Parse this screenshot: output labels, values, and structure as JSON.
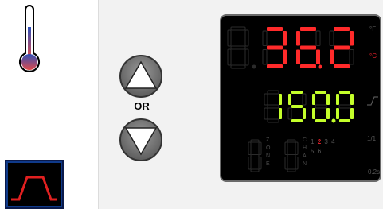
{
  "controls": {
    "or_label": "OR"
  },
  "display": {
    "process_value": "362",
    "process_value_ghost_digit": "8",
    "set_value": "150.0",
    "zone_digit": "8",
    "chan_digit": "8",
    "zone_label": [
      "Z",
      "O",
      "N",
      "E"
    ],
    "chan_label": [
      "C",
      "H",
      "A",
      "N"
    ],
    "unit_f": "°F",
    "unit_c": "°C",
    "active_unit": "°C",
    "channels_row1": [
      "1",
      "2",
      "3",
      "4"
    ],
    "channels_row2": [
      "5",
      "6"
    ],
    "active_channel": "2",
    "ramp_label": "1/1",
    "bottom_label": "0.2s"
  },
  "colors": {
    "process_red": "#ff2a2a",
    "setpoint_green": "#c4ff2a",
    "ghost_segment": "#2b2b2b",
    "thermo_fill_top": "#3b5cc4",
    "thermo_fill_bottom": "#e04a4a",
    "profile_icon_bg": "#0f3a8a",
    "profile_icon_line": "#e02020"
  }
}
